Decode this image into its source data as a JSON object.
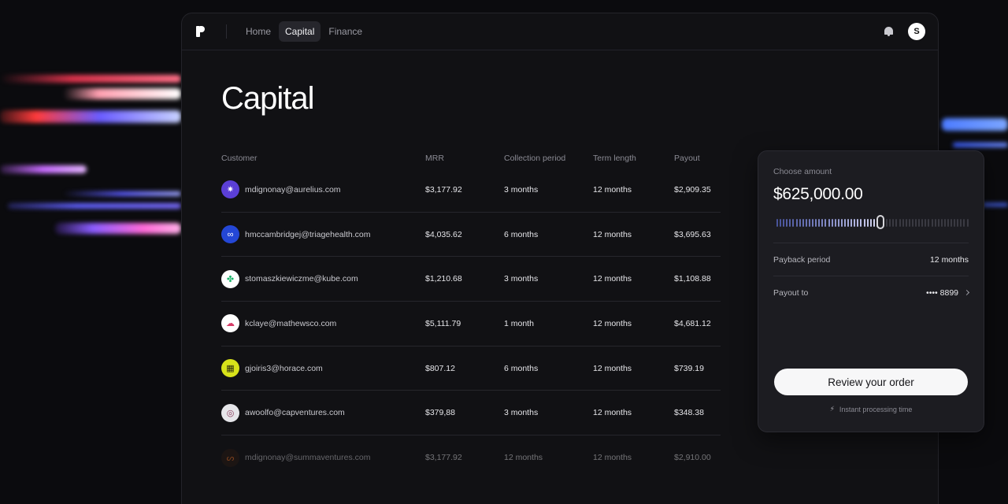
{
  "nav": {
    "items": [
      {
        "label": "Home",
        "active": false
      },
      {
        "label": "Capital",
        "active": true
      },
      {
        "label": "Finance",
        "active": false
      }
    ],
    "avatar_initial": "S"
  },
  "page": {
    "title": "Capital"
  },
  "table": {
    "headers": [
      "Customer",
      "MRR",
      "Collection period",
      "Term length",
      "Payout"
    ],
    "rows": [
      {
        "email": "mdignonay@aurelius.com",
        "mrr": "$3,177.92",
        "collection": "3 months",
        "term": "12 months",
        "payout": "$2,909.35",
        "icon_bg": "#5b3fd6",
        "icon_fg": "#ffffff",
        "icon": "badge-icon",
        "glyph": "✷"
      },
      {
        "email": "hmccambridgej@triagehealth.com",
        "mrr": "$4,035.62",
        "collection": "6 months",
        "term": "12 months",
        "payout": "$3,695.63",
        "icon_bg": "#2447d6",
        "icon_fg": "#ffffff",
        "icon": "rings-icon",
        "glyph": "∞"
      },
      {
        "email": "stomaszkiewiczme@kube.com",
        "mrr": "$1,210.68",
        "collection": "3 months",
        "term": "12 months",
        "payout": "$1,108.88",
        "icon_bg": "#ffffff",
        "icon_fg": "#1bb46a",
        "icon": "clover-icon",
        "glyph": "✤"
      },
      {
        "email": "kclaye@mathewsco.com",
        "mrr": "$5,111.79",
        "collection": "1 month",
        "term": "12 months",
        "payout": "$4,681.12",
        "icon_bg": "#ffffff",
        "icon_fg": "#d63a66",
        "icon": "cloud-icon",
        "glyph": "☁"
      },
      {
        "email": "gjoiris3@horace.com",
        "mrr": "$807.12",
        "collection": "6 months",
        "term": "12 months",
        "payout": "$739.19",
        "icon_bg": "#d7e21a",
        "icon_fg": "#2a2a10",
        "icon": "grid-icon",
        "glyph": "▦"
      },
      {
        "email": "awoolfo@capventures.com",
        "mrr": "$379,88",
        "collection": "3 months",
        "term": "12 months",
        "payout": "$348.38",
        "icon_bg": "#e6e6ea",
        "icon_fg": "#8a3a5a",
        "icon": "spiral-icon",
        "glyph": "◎"
      },
      {
        "email": "mdignonay@summaventures.com",
        "mrr": "$3,177.92",
        "collection": "12 months",
        "term": "12 months",
        "payout": "$2,910.00",
        "icon_bg": "#2a1a12",
        "icon_fg": "#ff7a2a",
        "icon": "flame-icon",
        "glyph": "ᔕ"
      }
    ]
  },
  "panel": {
    "choose_label": "Choose amount",
    "amount": "$625,000.00",
    "slider_level_percent": 54,
    "payback_label": "Payback period",
    "payback_value": "12 months",
    "payout_label": "Payout to",
    "payout_value": "•••• 8899",
    "button_label": "Review your order",
    "footnote": "Instant processing time"
  }
}
